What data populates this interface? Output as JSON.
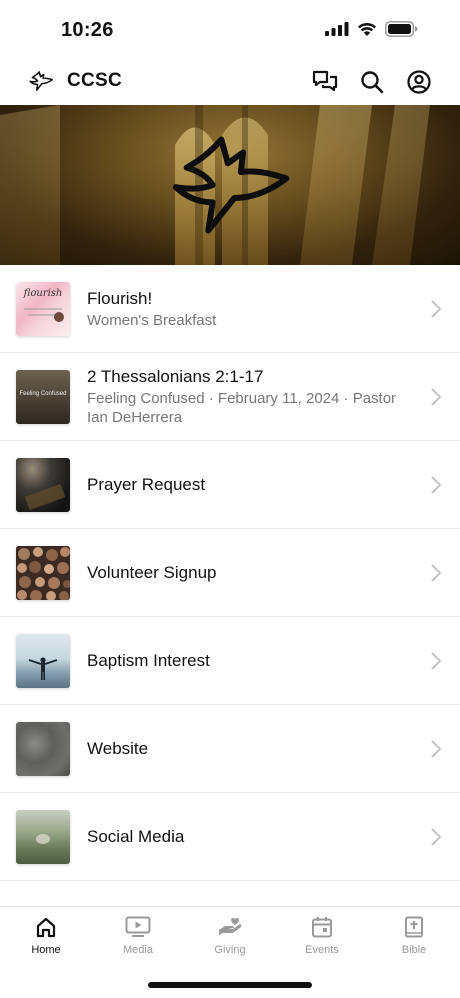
{
  "status_bar": {
    "time": "10:26"
  },
  "header": {
    "title": "CCSC",
    "icons": [
      "dove-logo-icon",
      "chat-icon",
      "search-icon",
      "account-icon"
    ]
  },
  "hero": {
    "icon": "dove-icon"
  },
  "list": [
    {
      "title": "Flourish!",
      "subtitle": "Women's Breakfast",
      "thumb_text": "flourish",
      "thumb_caption": ""
    },
    {
      "title": "2 Thessalonians 2:1-17",
      "subtitle": "Feeling Confused · February 11, 2024 · Pastor Ian DeHerrera",
      "thumb_text": "Feeling Confused",
      "thumb_caption": ""
    },
    {
      "title": "Prayer Request",
      "subtitle": ""
    },
    {
      "title": "Volunteer Signup",
      "subtitle": ""
    },
    {
      "title": "Baptism Interest",
      "subtitle": ""
    },
    {
      "title": "Website",
      "subtitle": ""
    },
    {
      "title": "Social Media",
      "subtitle": ""
    }
  ],
  "tabs": [
    {
      "label": "Home",
      "icon": "home-icon",
      "active": true
    },
    {
      "label": "Media",
      "icon": "media-icon",
      "active": false
    },
    {
      "label": "Giving",
      "icon": "giving-icon",
      "active": false
    },
    {
      "label": "Events",
      "icon": "events-icon",
      "active": false
    },
    {
      "label": "Bible",
      "icon": "bible-icon",
      "active": false
    }
  ],
  "colors": {
    "active_tab": "#111111",
    "inactive_tab": "#9a9a9a",
    "subtitle": "#777777",
    "divider": "#e8e8e8"
  }
}
